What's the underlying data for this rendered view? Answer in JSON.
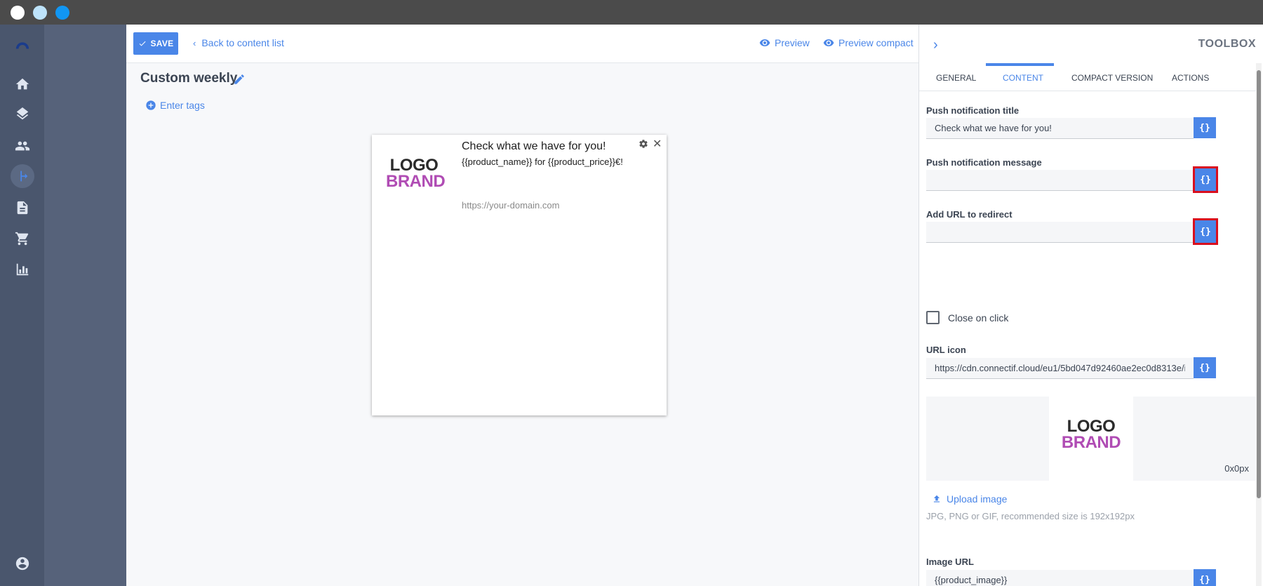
{
  "window": {
    "dots": [
      "#ffffff",
      "#bde3fb",
      "#1196f3"
    ]
  },
  "sidebar": {
    "items": [
      "logo-icon",
      "home-icon",
      "layers-icon",
      "people-icon",
      "workflow-icon",
      "document-icon",
      "cart-icon",
      "chart-icon",
      "account-icon"
    ]
  },
  "topbar": {
    "save_label": "SAVE",
    "back_label": "Back to content list",
    "preview_label": "Preview",
    "preview_compact_label": "Preview compact"
  },
  "content": {
    "title": "Custom weekly",
    "tags_label": "Enter tags"
  },
  "preview_card": {
    "logo_line1": "LOGO",
    "logo_line2": "BRAND",
    "title": "Check what we have for you!",
    "message": "{{product_name}} for {{product_price}}€!",
    "url": "https://your-domain.com",
    "close_glyph": "✕"
  },
  "toolbox": {
    "chevron": "›",
    "title": "TOOLBOX",
    "tabs": [
      "GENERAL",
      "CONTENT",
      "COMPACT VERSION",
      "ACTIONS"
    ],
    "active_tab": "CONTENT",
    "var_glyph": "{}",
    "fields": {
      "push_title_label": "Push notification title",
      "push_title_value": "Check what we have for you!",
      "push_message_label": "Push notification message",
      "push_message_value": "",
      "redirect_url_label": "Add URL to redirect",
      "redirect_url_value": "",
      "close_on_click_label": "Close on click",
      "url_icon_label": "URL icon",
      "url_icon_value": "https://cdn.connectif.cloud/eu1/5bd047d92460ae2ec0d8313e/images/c",
      "image_size": "0x0px",
      "upload_label": "Upload image",
      "upload_help": "JPG, PNG or GIF, recommended size is 192x192px",
      "image_url_label": "Image URL",
      "image_url_value": "{{product_image}}"
    },
    "logo_line1": "LOGO",
    "logo_line2": "BRAND"
  },
  "colors": {
    "accent": "#4a86e8",
    "highlight": "#d90f1e",
    "brand_purple": "#b04cb4"
  }
}
